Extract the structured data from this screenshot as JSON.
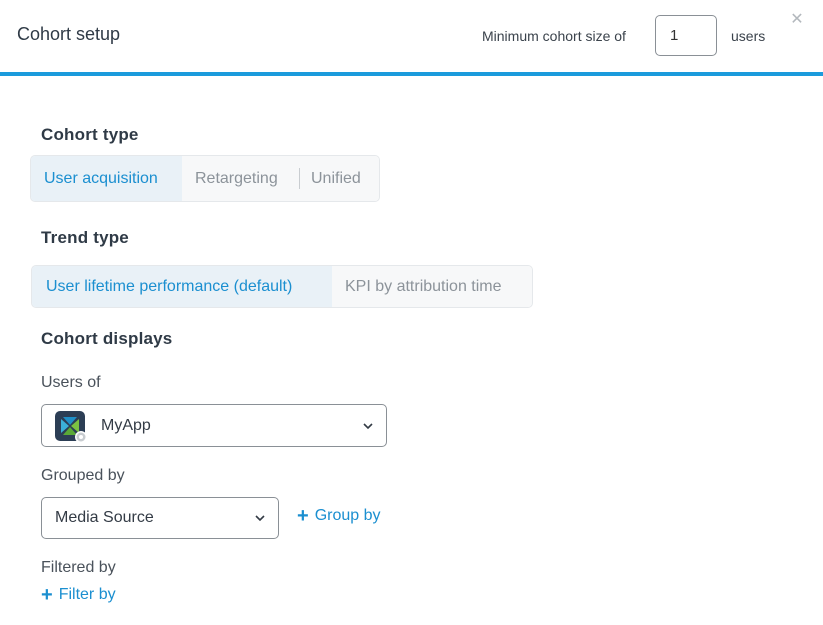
{
  "header": {
    "title": "Cohort setup",
    "min_size_label": "Minimum cohort size of",
    "min_size_value": "1",
    "users_label": "users",
    "close_icon": "close-icon"
  },
  "cohort_type": {
    "title": "Cohort type",
    "options": [
      "User acquisition",
      "Retargeting",
      "Unified"
    ],
    "selected": "User acquisition"
  },
  "trend_type": {
    "title": "Trend type",
    "options": [
      "User lifetime performance (default)",
      "KPI by attribution time"
    ],
    "selected": "User lifetime performance (default)"
  },
  "cohort_displays": {
    "title": "Cohort displays",
    "users_of_label": "Users of",
    "app_name": "MyApp",
    "app_icon": "app-logo-icon",
    "grouped_by_label": "Grouped by",
    "grouped_by_value": "Media Source",
    "group_by_link": "Group by",
    "filtered_by_label": "Filtered by",
    "filter_by_link": "Filter by"
  },
  "colors": {
    "accent": "#1b9bdc",
    "link": "#1b8fd0",
    "active_bg": "#e9f1f7",
    "inactive_text": "#8c939a"
  }
}
